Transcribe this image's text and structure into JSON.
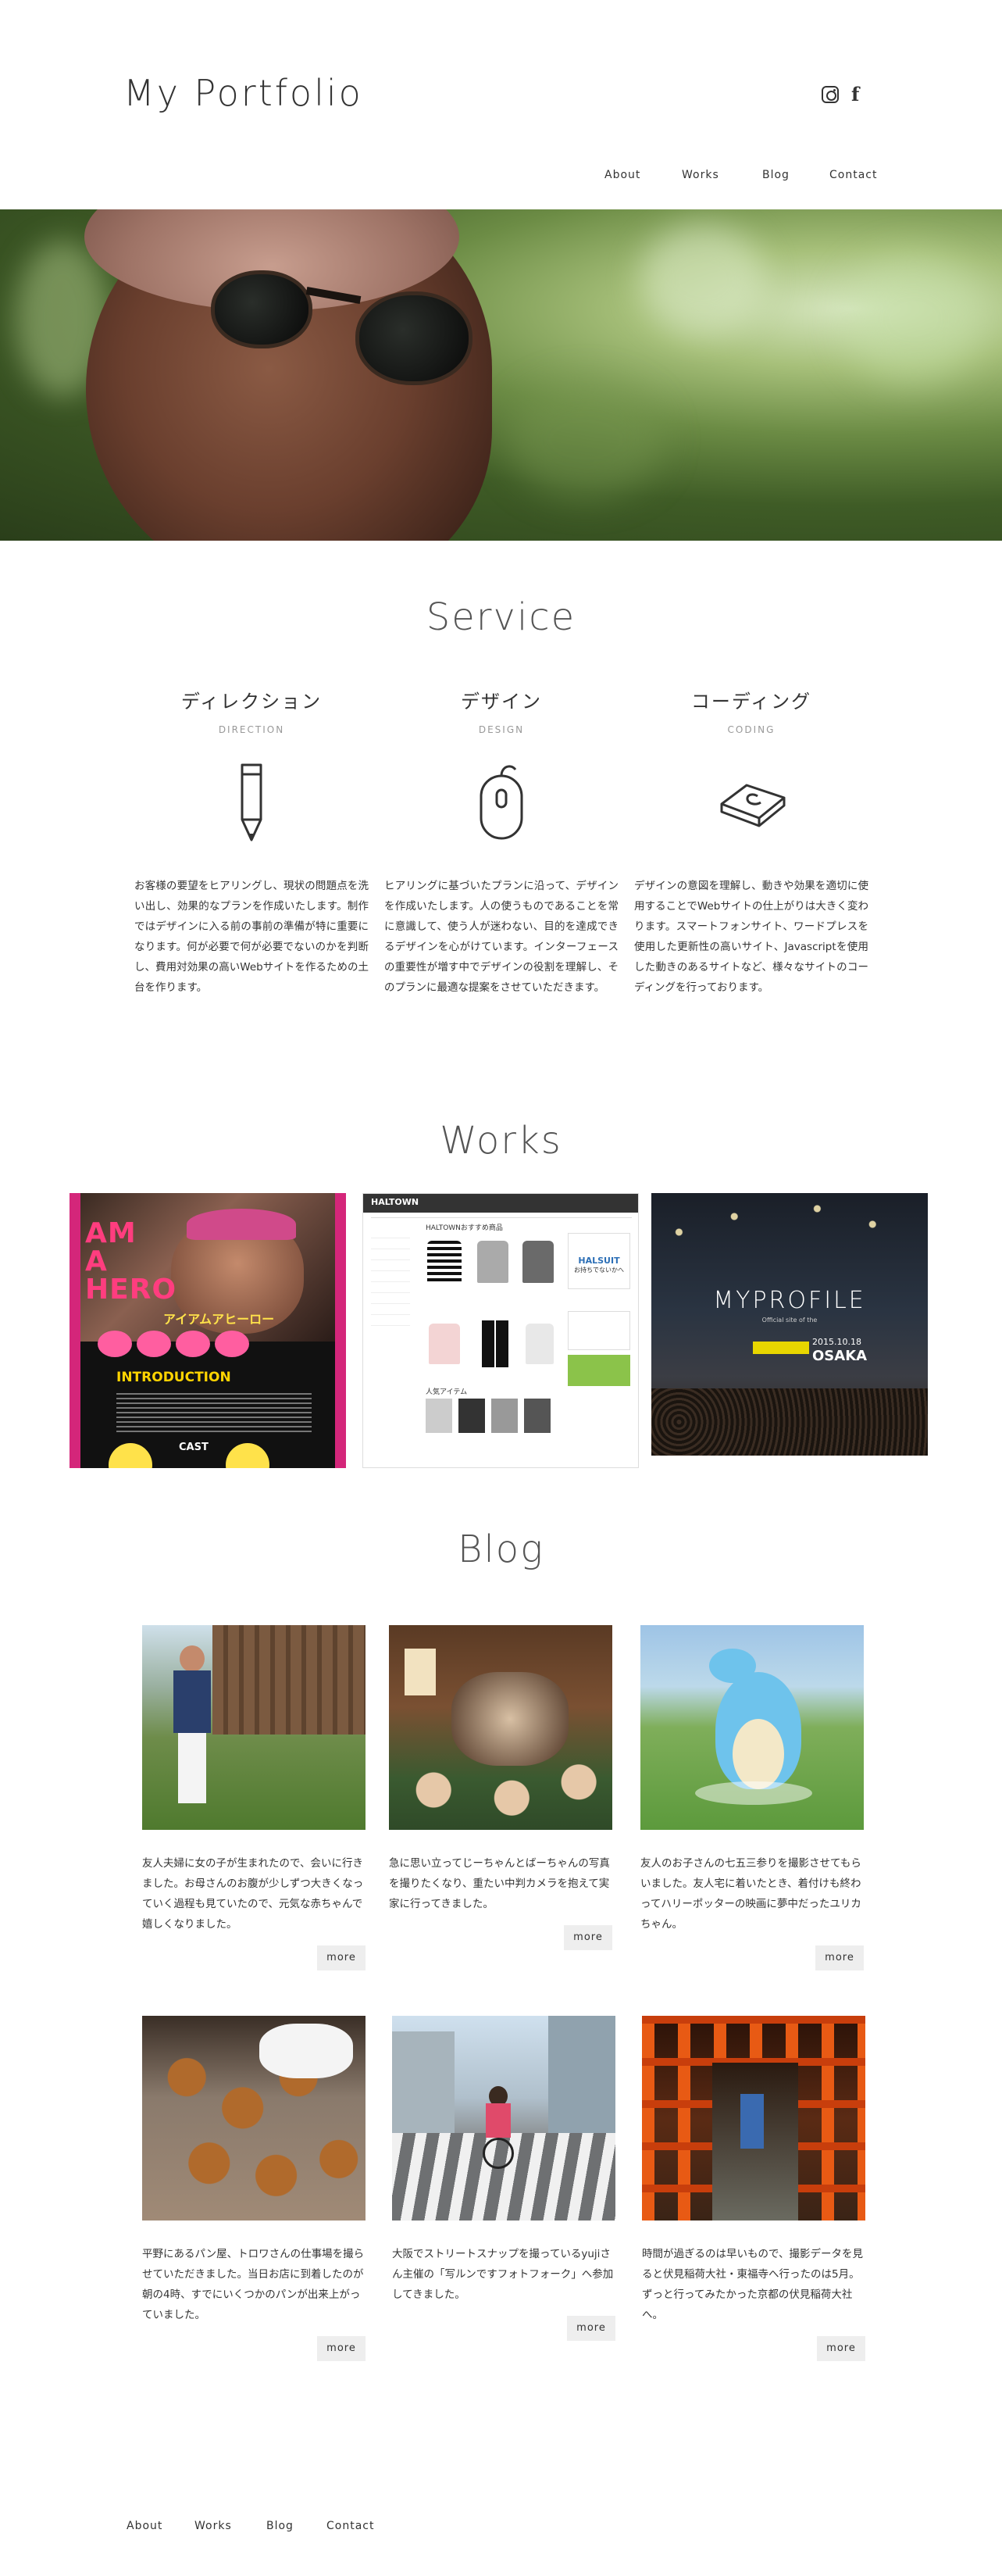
{
  "header": {
    "logo": "My Portfolio",
    "social": {
      "instagram_icon": "instagram-icon",
      "facebook_icon": "facebook-icon",
      "facebook_glyph": "f"
    },
    "nav": [
      "About",
      "Works",
      "Blog",
      "Contact"
    ]
  },
  "service": {
    "title": "Service",
    "items": [
      {
        "title": "ディレクション",
        "subtitle": "DIRECTION",
        "icon": "pencil-icon",
        "desc": "お客様の要望をヒアリングし、現状の問題点を洗い出し、効果的なプランを作成いたします。制作ではデザインに入る前の事前の準備が特に重要になります。何が必要で何が必要でないのかを判断し、費用対効果の高いWebサイトを作るための土台を作ります。"
      },
      {
        "title": "デザイン",
        "subtitle": "DESIGN",
        "icon": "mouse-icon",
        "desc": "ヒアリングに基づいたプランに沿って、デザインを作成いたします。人の使うものであることを常に意識して、使う人が迷わない、目的を達成できるデザインを心がけています。インターフェースの重要性が増す中でデザインの役割を理解し、そのプランに最適な提案をさせていただきます。"
      },
      {
        "title": "コーディング",
        "subtitle": "CODING",
        "icon": "keyboard-key-icon",
        "desc": "デザインの意図を理解し、動きや効果を適切に使用することでWebサイトの仕上がりは大きく変わります。スマートフォンサイト、ワードプレスを使用した更新性の高いサイト、Javascriptを使用した動きのあるサイトなど、様々なサイトのコーディングを行っております。"
      }
    ]
  },
  "works": {
    "title": "Works",
    "items": [
      {
        "name": "I AM A HERO",
        "heading": "アイアムアヒーロー",
        "intro": "INTRODUCTION",
        "cast": "CAST"
      },
      {
        "name": "HALTOWN",
        "heading": "HALTOWNおすすめ商品",
        "banner": "HALSUIT",
        "banner_sub": "お持ちでないかへ",
        "section": "人気アイテム"
      },
      {
        "name": "MYPROFILE",
        "tagline": "Official site of the",
        "date": "2015.10.18",
        "place": "OSAKA"
      }
    ]
  },
  "blog": {
    "title": "Blog",
    "more_label": "more",
    "posts": [
      {
        "text": "友人夫婦に女の子が生まれたので、会いに行きました。お母さんのお腹が少しずつ大きくなっていく過程も見ていたので、元気な赤ちゃんで嬉しくなりました。"
      },
      {
        "text": "急に思い立ってじーちゃんとばーちゃんの写真を撮りたくなり、重たい中判カメラを抱えて実家に行ってきました。"
      },
      {
        "text": "友人のお子さんの七五三参りを撮影させてもらいました。友人宅に着いたとき、着付けも終わってハリーポッターの映画に夢中だったユリカちゃん。"
      },
      {
        "text": "平野にあるパン屋、トロワさんの仕事場を撮らせていただきました。当日お店に到着したのが朝の4時、すでにいくつかのパンが出来上がっていました。"
      },
      {
        "text": "大阪でストリートスナップを撮っているyujiさん主催の「写ルンですフォトフォーク」へ参加してきました。"
      },
      {
        "text": "時間が過ぎるのは早いもので、撮影データを見ると伏見稲荷大社・東福寺へ行ったのは5月。ずっと行ってみたかった京都の伏見稲荷大社へ。"
      }
    ]
  },
  "footer": {
    "nav": [
      "About",
      "Works",
      "Blog",
      "Contact"
    ]
  },
  "colors": {
    "text": "#333333",
    "muted": "#999999",
    "more_bg": "#eeeeee",
    "works_pink": "#d4267a"
  }
}
